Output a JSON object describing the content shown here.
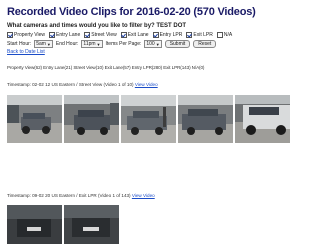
{
  "header": {
    "title": "Recorded Video Clips for 2016-02-20 (570 Videos)",
    "question": "What cameras and times would you like to filter by? TEST DOT"
  },
  "filters": [
    {
      "label": "Property View",
      "checked": true
    },
    {
      "label": "Entry Lane",
      "checked": true
    },
    {
      "label": "Street View",
      "checked": true
    },
    {
      "label": "Exit Lane",
      "checked": true
    },
    {
      "label": "Entry LPR",
      "checked": true
    },
    {
      "label": "Exit LPR",
      "checked": true
    },
    {
      "label": "N/A",
      "checked": false
    }
  ],
  "controls": {
    "start_label": "Start Hour:",
    "start_value": "5am",
    "end_label": "End Hour:",
    "end_value": "11pm",
    "items_label": "Items Per Page:",
    "items_value": "100",
    "submit": "Submit",
    "reset": "Reset"
  },
  "back_link": "Back to Date List",
  "counts": "Property View(62)  Entry Lane(21)  Street View(10)  Exit Lane(57)  Entry LPR(280)  Exit LPR(143)  N/A(0)",
  "groups": [
    {
      "timestamp": "Timestamp: 02-02 12 US Eastern / Street View (Video 1 of 10)",
      "link": "View Video",
      "thumbnail_count": 5
    },
    {
      "timestamp": "Timestamp: 09-02 20 US Eastern / Exit LPR (Video 1 of 143)",
      "link": "View Video",
      "thumbnail_count": 2
    }
  ],
  "colors": {
    "title": "#1a1a66",
    "link": "#1a4cc8"
  }
}
